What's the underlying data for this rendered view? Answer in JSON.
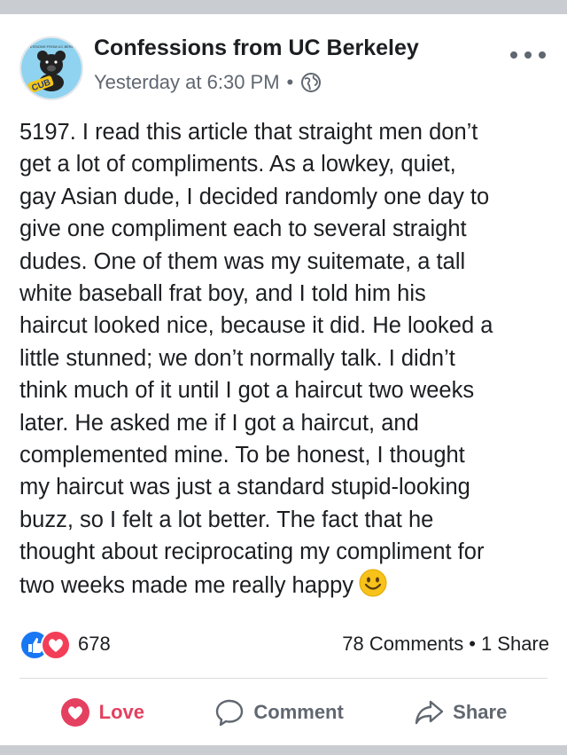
{
  "header": {
    "page_name": "Confessions from UC Berkeley",
    "timestamp": "Yesterday at 6:30 PM",
    "separator": "•",
    "privacy_icon": "globe-icon",
    "avatar_label": "CUB"
  },
  "post": {
    "text": "5197. I read this article that straight men don’t\nget a lot of compliments. As a lowkey, quiet,\ngay Asian dude, I decided randomly one day to\ngive one compliment each to several straight\ndudes. One of them was my suitemate, a tall\nwhite baseball frat boy, and I told him his\nhaircut looked nice, because it did. He looked a\nlittle stunned; we don’t normally talk. I didn’t\nthink much of it until I got a haircut two weeks\nlater. He asked me if I got a haircut, and\ncomplemented mine. To be honest, I thought\nmy haircut was just a standard stupid-looking\nbuzz, so I felt a lot better. The fact that he\nthought about reciprocating my compliment for\ntwo weeks made me really happy",
    "emoji_icon": "smiley-emoji-icon"
  },
  "stats": {
    "reaction_count": "678",
    "comments": "78 Comments",
    "dot": "•",
    "shares": "1 Share"
  },
  "actions": {
    "love": "Love",
    "comment": "Comment",
    "share": "Share"
  },
  "colors": {
    "love": "#e4405f",
    "like": "#1877f2",
    "secondary_text": "#606770",
    "background": "#c9ccd1"
  }
}
